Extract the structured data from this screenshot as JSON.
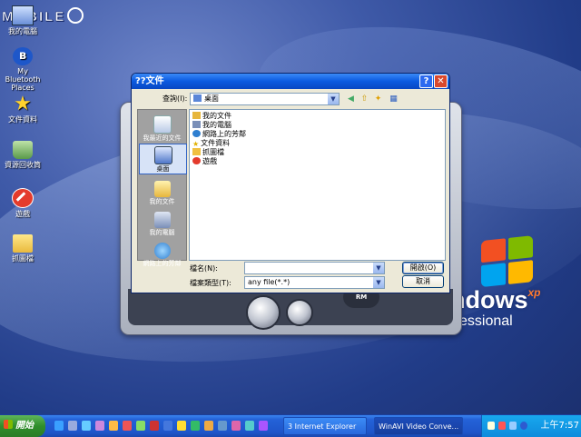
{
  "watermark": "MOBILE",
  "desktop": {
    "icons": [
      {
        "label": "我的電腦",
        "icon": "computer-icon"
      },
      {
        "label": "My Bluetooth Places",
        "icon": "bluetooth-icon"
      },
      {
        "label": "文件資料",
        "icon": "star-icon"
      },
      {
        "label": "資源回收筒",
        "icon": "recycle-bin-icon"
      },
      {
        "label": "遊戲",
        "icon": "no-entry-icon"
      },
      {
        "label": "抓圖檔",
        "icon": "folder-icon"
      }
    ]
  },
  "xp_logo": {
    "text": "ndows",
    "edition": "xp",
    "sub": "essional"
  },
  "player": {
    "button_label": "RM"
  },
  "dialog": {
    "title": "??文件",
    "look_in_label": "查詢(I):",
    "look_in_value": "桌面",
    "places": [
      {
        "label": "我最近的文件",
        "icon": "recent-documents-icon"
      },
      {
        "label": "桌面",
        "icon": "desktop-icon",
        "selected": true
      },
      {
        "label": "我的文件",
        "icon": "my-documents-icon"
      },
      {
        "label": "我的電腦",
        "icon": "my-computer-icon"
      },
      {
        "label": "網路上的芳鄰",
        "icon": "network-places-icon"
      }
    ],
    "files": [
      {
        "label": "我的文件",
        "icon": "my-documents-icon"
      },
      {
        "label": "我的電腦",
        "icon": "my-computer-icon"
      },
      {
        "label": "網路上的芳鄰",
        "icon": "network-places-icon"
      },
      {
        "label": "文件資料",
        "icon": "star-icon"
      },
      {
        "label": "抓圖檔",
        "icon": "folder-icon"
      },
      {
        "label": "遊戲",
        "icon": "no-entry-icon"
      }
    ],
    "filename_label": "檔名(N):",
    "filename_value": "",
    "filetype_label": "檔案類型(T):",
    "filetype_value": "any file(*.*)",
    "open_button": "開啟(O)",
    "cancel_button": "取消"
  },
  "taskbar": {
    "start_label": "開始",
    "tasks": [
      {
        "label": "3 Internet Explorer",
        "active": false
      },
      {
        "label": "WinAVI Video Conve...",
        "active": true
      }
    ],
    "clock": "上午7:57"
  },
  "colors": {
    "title_blue": "#0a5ae0",
    "taskbar_blue": "#2462d8",
    "start_green": "#2f8e2b",
    "close_red": "#d9482d"
  }
}
